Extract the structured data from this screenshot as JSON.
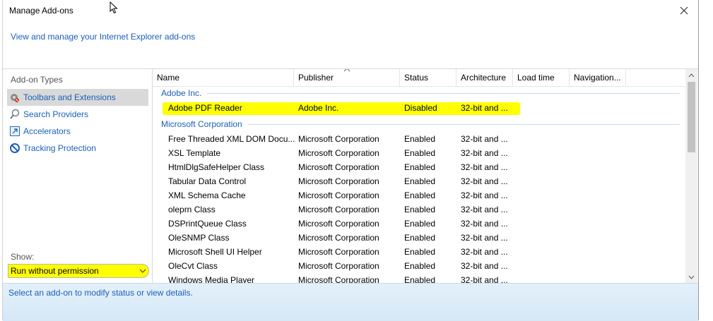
{
  "window": {
    "title": "Manage Add-ons",
    "header_link": "View and manage your Internet Explorer add-ons"
  },
  "sidebar": {
    "heading": "Add-on Types",
    "items": [
      {
        "label": "Toolbars and Extensions",
        "icon": "gear-icon",
        "selected": true
      },
      {
        "label": "Search Providers",
        "icon": "search-icon",
        "selected": false
      },
      {
        "label": "Accelerators",
        "icon": "accelerator-icon",
        "selected": false
      },
      {
        "label": "Tracking Protection",
        "icon": "block-icon",
        "selected": false
      }
    ],
    "show_label": "Show:",
    "show_value": "Run without permission"
  },
  "table": {
    "columns": [
      "Name",
      "Publisher",
      "Status",
      "Architecture",
      "Load time",
      "Navigation..."
    ],
    "groups": [
      {
        "name": "Adobe Inc.",
        "rows": [
          {
            "name": "Adobe PDF Reader",
            "publisher": "Adobe Inc.",
            "status": "Disabled",
            "arch": "32-bit and ..."
          }
        ]
      },
      {
        "name": "Microsoft Corporation",
        "rows": [
          {
            "name": "Free Threaded XML DOM Docu...",
            "publisher": "Microsoft Corporation",
            "status": "Enabled",
            "arch": "32-bit and ..."
          },
          {
            "name": "XSL Template",
            "publisher": "Microsoft Corporation",
            "status": "Enabled",
            "arch": "32-bit and ..."
          },
          {
            "name": "HtmlDlgSafeHelper Class",
            "publisher": "Microsoft Corporation",
            "status": "Enabled",
            "arch": "32-bit and ..."
          },
          {
            "name": "Tabular Data Control",
            "publisher": "Microsoft Corporation",
            "status": "Enabled",
            "arch": "32-bit and ..."
          },
          {
            "name": "XML Schema Cache",
            "publisher": "Microsoft Corporation",
            "status": "Enabled",
            "arch": "32-bit and ..."
          },
          {
            "name": "oleprn Class",
            "publisher": "Microsoft Corporation",
            "status": "Enabled",
            "arch": "32-bit and ..."
          },
          {
            "name": "DSPrintQueue Class",
            "publisher": "Microsoft Corporation",
            "status": "Enabled",
            "arch": "32-bit and ..."
          },
          {
            "name": "OleSNMP Class",
            "publisher": "Microsoft Corporation",
            "status": "Enabled",
            "arch": "32-bit and ..."
          },
          {
            "name": "Microsoft Shell UI Helper",
            "publisher": "Microsoft Corporation",
            "status": "Enabled",
            "arch": "32-bit and ..."
          },
          {
            "name": "OleCvt Class",
            "publisher": "Microsoft Corporation",
            "status": "Enabled",
            "arch": "32-bit and ..."
          },
          {
            "name": "Windows Media Player",
            "publisher": "Microsoft Corporation",
            "status": "Enabled",
            "arch": "32-bit and ..."
          }
        ]
      }
    ]
  },
  "details": {
    "text": "Select an add-on to modify status or view details."
  },
  "colors": {
    "link": "#1c5fb8",
    "highlight": "#ffff00"
  }
}
